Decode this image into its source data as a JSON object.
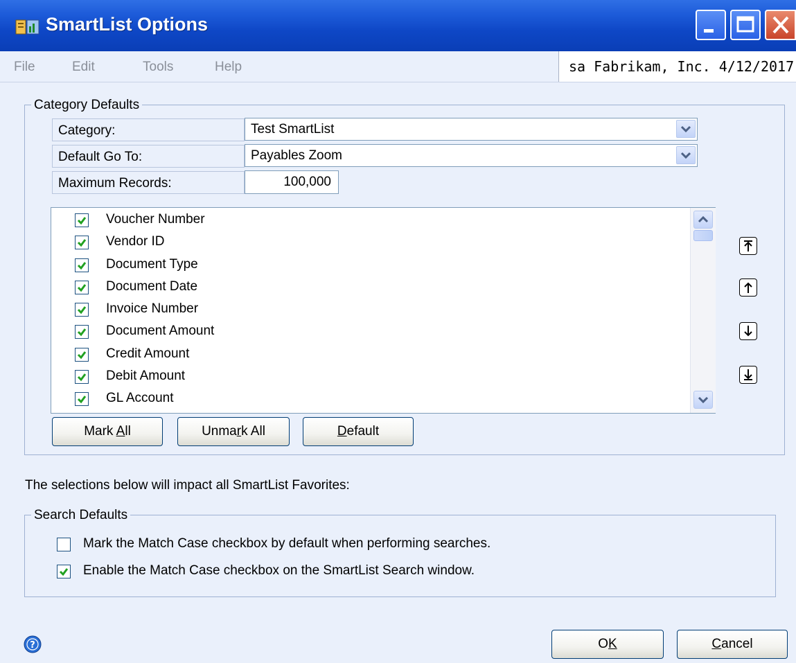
{
  "window": {
    "title": "SmartList Options"
  },
  "menu": {
    "items": [
      "File",
      "Edit",
      "Tools",
      "Help"
    ]
  },
  "status": {
    "user": "sa",
    "company": "Fabrikam, Inc.",
    "date": "4/12/2017",
    "text": "sa  Fabrikam, Inc.  4/12/2017"
  },
  "category_defaults": {
    "group_label": "Category Defaults",
    "category_label": "Category:",
    "category_value": "Test SmartList",
    "goto_label": "Default Go To:",
    "goto_value": "Payables Zoom",
    "max_records_label": "Maximum Records:",
    "max_records_value": "100,000",
    "columns": [
      {
        "label": "Voucher Number",
        "checked": true
      },
      {
        "label": "Vendor ID",
        "checked": true
      },
      {
        "label": "Document Type",
        "checked": true
      },
      {
        "label": "Document Date",
        "checked": true
      },
      {
        "label": "Invoice Number",
        "checked": true
      },
      {
        "label": "Document Amount",
        "checked": true
      },
      {
        "label": "Credit Amount",
        "checked": true
      },
      {
        "label": "Debit Amount",
        "checked": true
      },
      {
        "label": "GL Account",
        "checked": true
      }
    ],
    "buttons": {
      "mark_all_pre": "Mark ",
      "mark_all_u": "A",
      "mark_all_post": "ll",
      "unmark_all_pre": "Unma",
      "unmark_all_u": "r",
      "unmark_all_post": "k All",
      "default_u": "D",
      "default_post": "efault"
    }
  },
  "info_text": "The selections below will impact all SmartList Favorites:",
  "search_defaults": {
    "group_label": "Search Defaults",
    "options": [
      {
        "label": "Mark the Match Case checkbox by default when performing searches.",
        "checked": false
      },
      {
        "label": "Enable the Match Case checkbox on the SmartList Search window.",
        "checked": true
      }
    ]
  },
  "footer": {
    "ok_pre": "O",
    "ok_u": "K",
    "cancel_u": "C",
    "cancel_post": "ancel"
  },
  "colors": {
    "titlebar": "#0a3eb6",
    "body": "#eaf0fb",
    "check": "#21a121"
  },
  "icons": [
    "app-icon",
    "minimize-icon",
    "maximize-icon",
    "close-icon",
    "chevron-down-icon",
    "scroll-up-icon",
    "scroll-down-icon",
    "move-top-icon",
    "move-up-icon",
    "move-down-icon",
    "move-bottom-icon",
    "help-icon"
  ]
}
